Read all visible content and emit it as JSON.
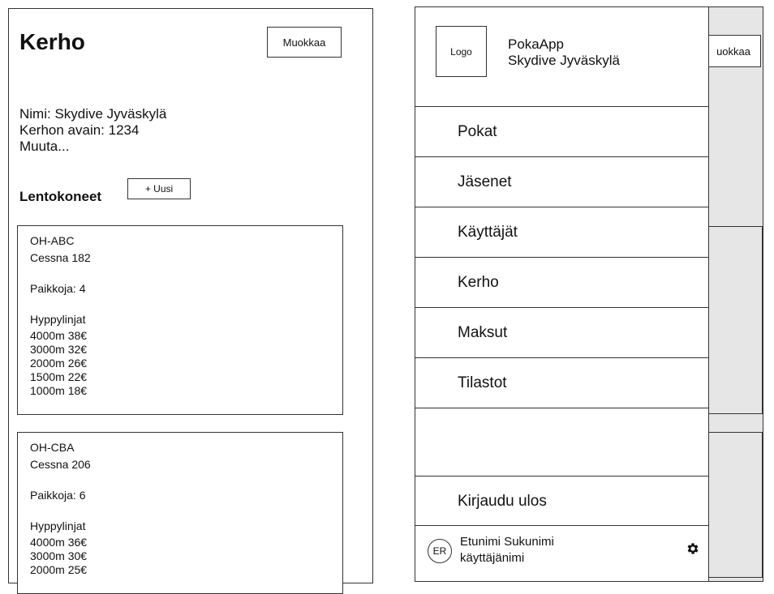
{
  "club_page": {
    "title": "Kerho",
    "edit_label": "Muokkaa",
    "info": [
      "Nimi: Skydive Jyväskylä",
      "Kerhon avain: 1234",
      "Muuta..."
    ],
    "aircraft_heading": "Lentokoneet",
    "new_label": "+ Uusi",
    "aircraft": [
      {
        "reg": "OH-ABC",
        "model": "Cessna 182",
        "seats": "Paikkoja: 4",
        "lines_heading": "Hyppylinjat",
        "lines": [
          "4000m 38€",
          "3000m 32€",
          "2000m 26€",
          "1500m 22€",
          "1000m 18€"
        ]
      },
      {
        "reg": "OH-CBA",
        "model": "Cessna 206",
        "seats": "Paikkoja: 6",
        "lines_heading": "Hyppylinjat",
        "lines": [
          "4000m 36€",
          "3000m 30€",
          "2000m 25€"
        ]
      }
    ]
  },
  "background": {
    "edit_label_partial": "uokkaa"
  },
  "drawer": {
    "logo": "Logo",
    "app_name": "PokaApp",
    "club_name": "Skydive Jyväskylä",
    "menu": [
      "Pokat",
      "Jäsenet",
      "Käyttäjät",
      "Kerho",
      "Maksut",
      "Tilastot"
    ],
    "logout": "Kirjaudu ulos",
    "user": {
      "initials": "ER",
      "full_name": "Etunimi Sukunimi",
      "username": "käyttäjänimi"
    },
    "settings_icon": "gear-icon"
  }
}
